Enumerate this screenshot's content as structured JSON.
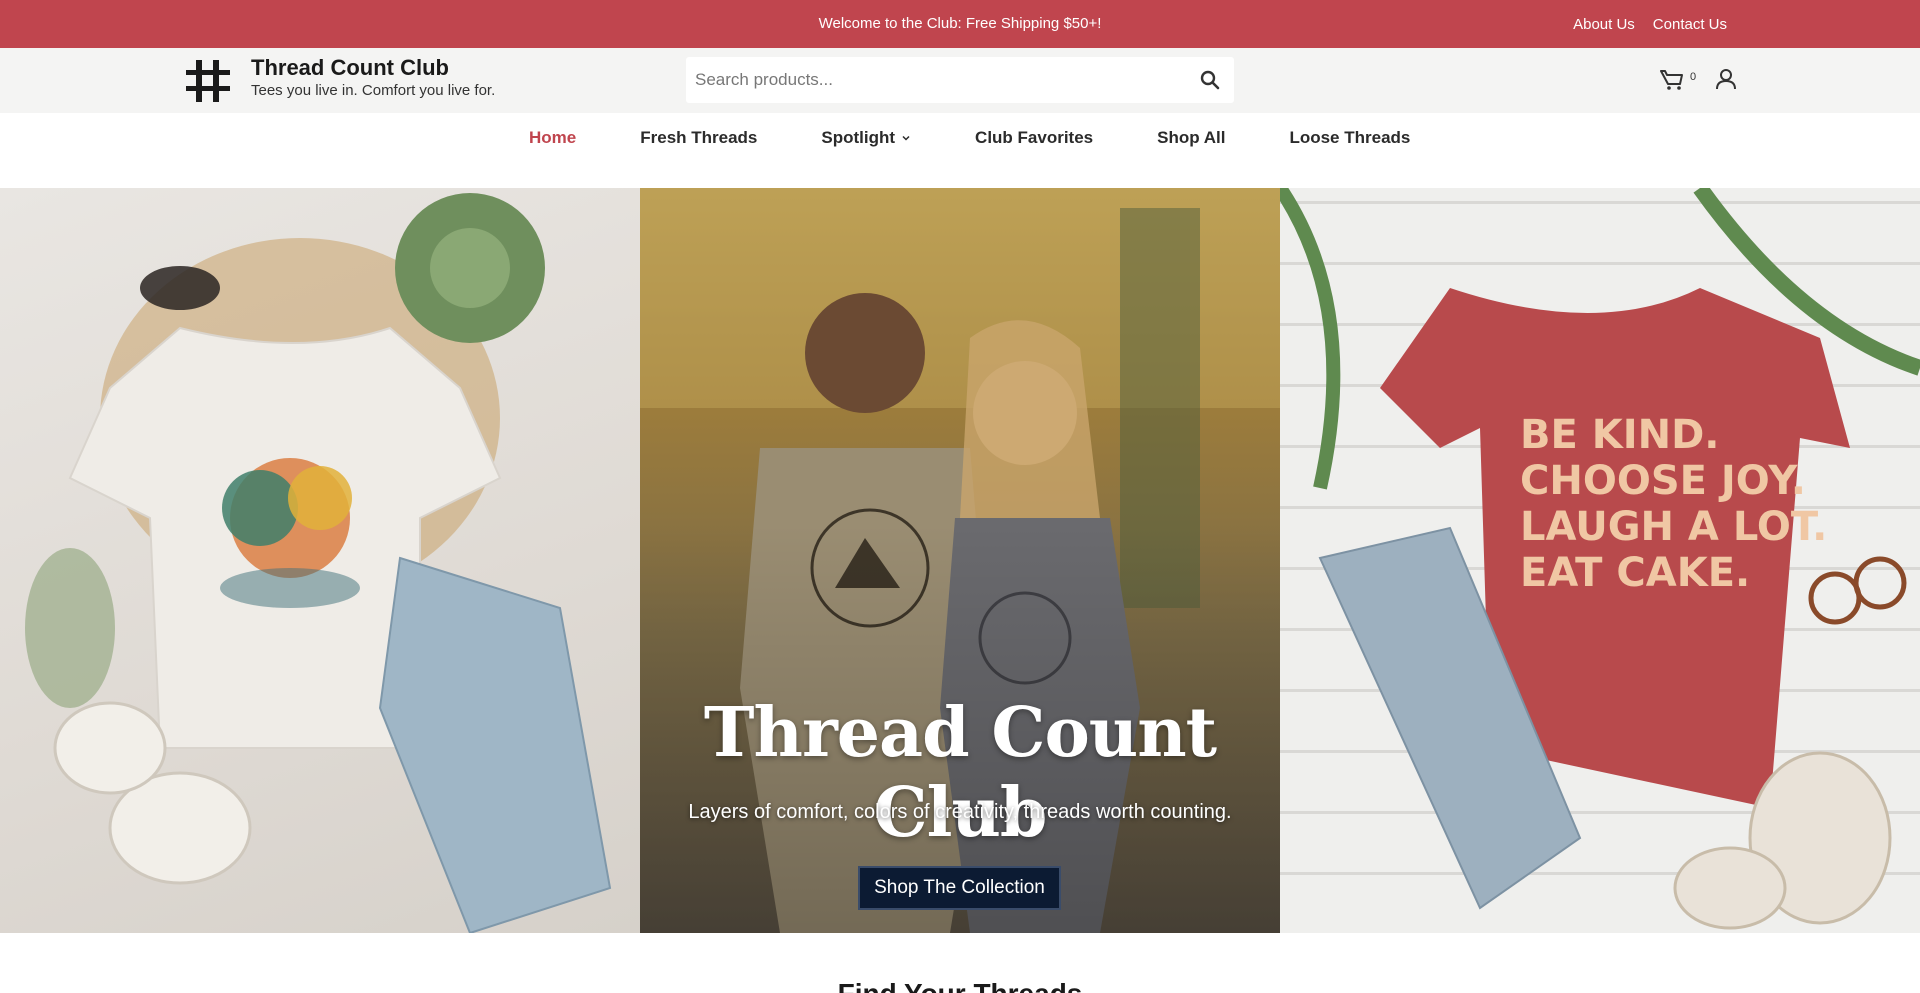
{
  "announcement": {
    "message": "Welcome to the Club: Free Shipping $50+!",
    "links": [
      "About Us",
      "Contact Us"
    ]
  },
  "header": {
    "brand_name": "Thread Count Club",
    "tagline": "Tees you live in. Comfort you live for.",
    "search_placeholder": "Search products...",
    "cart_count": "0",
    "icons": [
      "hashtag-logo-icon",
      "search-icon",
      "cart-icon",
      "account-icon"
    ]
  },
  "nav": {
    "items": [
      {
        "label": "Home",
        "active": true
      },
      {
        "label": "Fresh Threads"
      },
      {
        "label": "Spotlight",
        "has_dropdown": true
      },
      {
        "label": "Club Favorites"
      },
      {
        "label": "Shop All"
      },
      {
        "label": "Loose Threads"
      }
    ]
  },
  "hero": {
    "title": "Thread Count Club",
    "subtitle": "Layers of comfort, colors of creativity, threads worth counting.",
    "button": "Shop The Collection",
    "right_tee_text": [
      "BE KIND.",
      "CHOOSE JOY.",
      "LAUGH A LOT.",
      "EAT CAKE."
    ]
  },
  "section": {
    "heading": "Find Your Threads"
  },
  "colors": {
    "accent": "#c0454e",
    "button": "#0c1b33"
  }
}
